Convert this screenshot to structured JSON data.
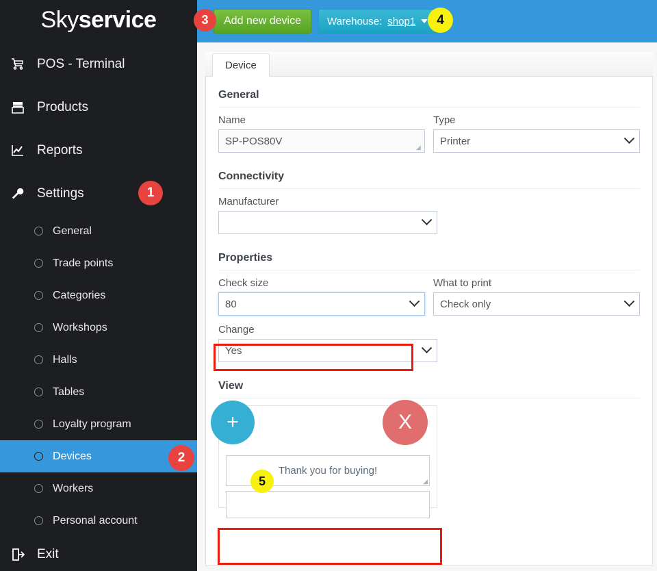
{
  "brand": {
    "part1": "Sky",
    "part2": "service"
  },
  "sidebar": {
    "main_items": [
      {
        "label": "POS - Terminal",
        "icon": "cart-icon",
        "glyph": "☗"
      },
      {
        "label": "Products",
        "icon": "products-icon",
        "glyph": "☰"
      },
      {
        "label": "Reports",
        "icon": "chart-icon",
        "glyph": "↗"
      },
      {
        "label": "Settings",
        "icon": "wrench-icon",
        "glyph": "⚒"
      }
    ],
    "sub_items": [
      {
        "label": "General",
        "active": false
      },
      {
        "label": "Trade points",
        "active": false
      },
      {
        "label": "Categories",
        "active": false
      },
      {
        "label": "Workshops",
        "active": false
      },
      {
        "label": "Halls",
        "active": false
      },
      {
        "label": "Tables",
        "active": false
      },
      {
        "label": "Loyalty program",
        "active": false
      },
      {
        "label": "Devices",
        "active": true
      },
      {
        "label": "Workers",
        "active": false
      },
      {
        "label": "Personal account",
        "active": false
      }
    ],
    "exit": {
      "label": "Exit",
      "icon": "exit-icon",
      "glyph": "⇥"
    }
  },
  "header": {
    "add_device_label": "Add new device",
    "warehouse_prefix": "Warehouse:",
    "warehouse_value": "shop1"
  },
  "tabs": [
    {
      "label": "Device",
      "active": true
    }
  ],
  "sections": {
    "general": {
      "title": "General",
      "name_label": "Name",
      "name_value": "SP-POS80V",
      "type_label": "Type",
      "type_value": "Printer"
    },
    "connectivity": {
      "title": "Connectivity",
      "manufacturer_label": "Manufacturer",
      "manufacturer_value": ""
    },
    "properties": {
      "title": "Properties",
      "check_size_label": "Check size",
      "check_size_value": "80",
      "what_to_print_label": "What to print",
      "what_to_print_value": "Check only",
      "change_label": "Change",
      "change_value": "Yes"
    },
    "view": {
      "title": "View",
      "add_line_label": "+",
      "remove_label": "X",
      "line_text": "Thank you for buying!"
    }
  },
  "badges": [
    {
      "num": "1",
      "color": "red"
    },
    {
      "num": "2",
      "color": "red"
    },
    {
      "num": "3",
      "color": "red"
    },
    {
      "num": "4",
      "color": "yellow"
    },
    {
      "num": "5",
      "color": "yellow"
    }
  ],
  "colors": {
    "sidebar_bg": "#1d1e22",
    "header_blue": "#3598dc",
    "active_blue": "#3598dc",
    "add_green": "#57a423",
    "warehouse_cyan": "#1ba3c4",
    "badge_red": "#e8433f",
    "badge_yellow": "#f7f10c",
    "highlight_red": "#e81d0e",
    "plus_cyan": "#35b0d4",
    "x_red": "#e06e6e"
  }
}
